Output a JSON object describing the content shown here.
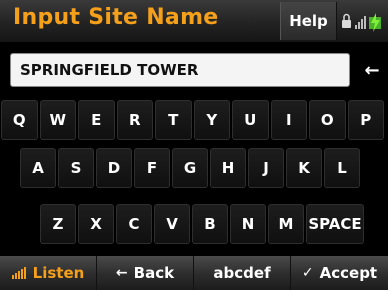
{
  "header": {
    "title": "Input Site Name",
    "help_label": "Help",
    "status_icons": [
      "lock-icon",
      "signal-bars-icon",
      "battery-charging-icon"
    ]
  },
  "input": {
    "value": "SPRINGFIELD TOWER",
    "backspace_icon": "←"
  },
  "keyboard": {
    "row1": [
      "Q",
      "W",
      "E",
      "R",
      "T",
      "Y",
      "U",
      "I",
      "O",
      "P"
    ],
    "row2": [
      "A",
      "S",
      "D",
      "F",
      "G",
      "H",
      "J",
      "K",
      "L"
    ],
    "row3": [
      "Z",
      "X",
      "C",
      "V",
      "B",
      "N",
      "M",
      "SPACE"
    ]
  },
  "bottom_bar": {
    "listen_label": "Listen",
    "back_arrow": "←",
    "back_label": "Back",
    "mode_label": "abcdef",
    "accept_check": "✓",
    "accept_label": "Accept"
  },
  "colors": {
    "accent": "#f5a01b",
    "background": "#000000",
    "input_bg": "#f4f4f4"
  }
}
